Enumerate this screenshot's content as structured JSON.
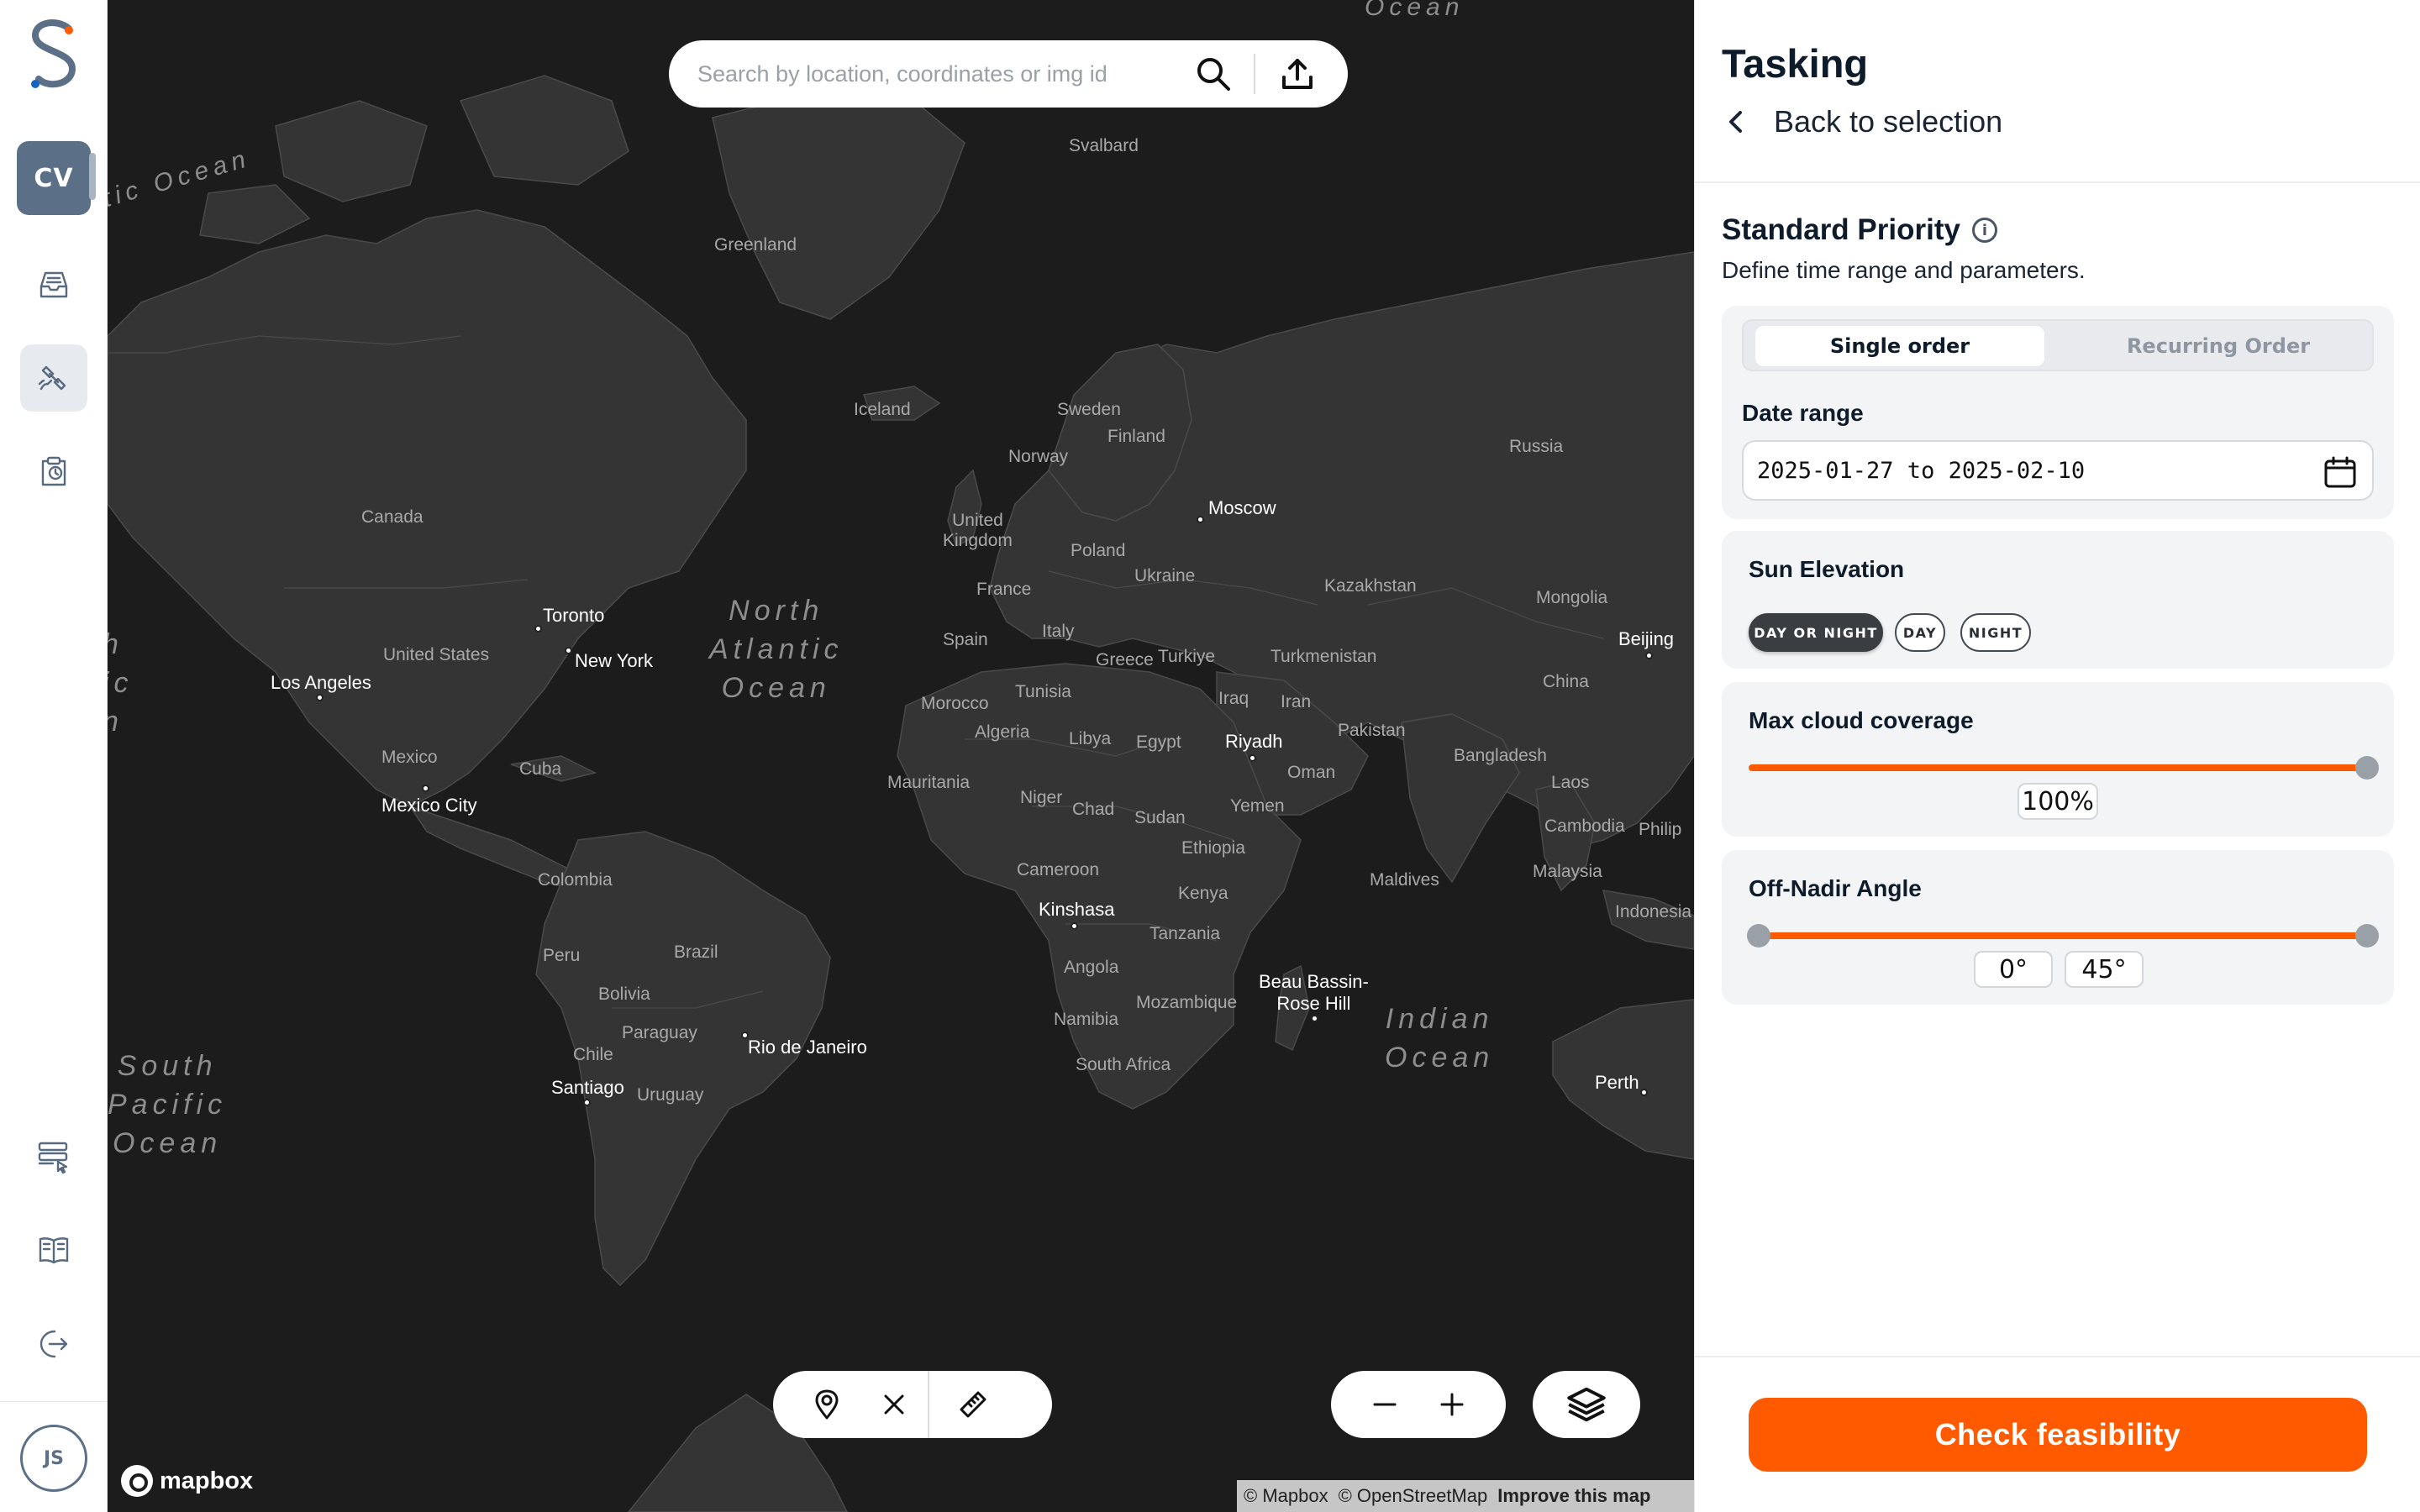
{
  "rail": {
    "workspace_initials": "CV",
    "user_initials": "JS",
    "items": [
      {
        "icon": "inbox-icon"
      },
      {
        "icon": "satellite-icon",
        "active": true
      },
      {
        "icon": "history-clipboard-icon"
      },
      {
        "icon": "api-settings-icon"
      },
      {
        "icon": "book-icon"
      },
      {
        "icon": "logout-icon"
      }
    ]
  },
  "search": {
    "placeholder": "Search by location, coordinates or img id"
  },
  "map": {
    "labels": {
      "arctic": "tic Ocean",
      "svalbard": "Svalbard",
      "greenland": "Greenland",
      "iceland": "Iceland",
      "sweden": "Sweden",
      "finland": "Finland",
      "norway": "Norway",
      "russia": "Russia",
      "canada": "Canada",
      "uk": "United\nKingdom",
      "moscow": "Moscow",
      "poland": "Poland",
      "ukraine": "Ukraine",
      "france": "France",
      "kazakhstan": "Kazakhstan",
      "mongolia": "Mongolia",
      "toronto": "Toronto",
      "new_york": "New York",
      "united_states": "United States",
      "los_angeles": "Los Angeles",
      "north_atlantic": "North\nAtlantic\nOcean",
      "spain": "Spain",
      "italy": "Italy",
      "greece": "Greece",
      "turkiye": "Turkiye",
      "turkmenistan": "Turkmenistan",
      "beijing": "Beijing",
      "china": "China",
      "tunisia": "Tunisia",
      "morocco": "Morocco",
      "iraq": "Iraq",
      "iran": "Iran",
      "algeria": "Algeria",
      "libya": "Libya",
      "egypt": "Egypt",
      "riyadh": "Riyadh",
      "pakistan": "Pakistan",
      "mexico": "Mexico",
      "cuba": "Cuba",
      "mexico_city": "Mexico City",
      "mauritania": "Mauritania",
      "niger": "Niger",
      "chad": "Chad",
      "sudan": "Sudan",
      "oman": "Oman",
      "bangladesh": "Bangladesh",
      "yemen": "Yemen",
      "laos": "Laos",
      "ethiopia": "Ethiopia",
      "cambodia": "Cambodia",
      "philippines": "Philip",
      "colombia": "Colombia",
      "cameroon": "Cameroon",
      "kenya": "Kenya",
      "malaysia": "Malaysia",
      "maldives": "Maldives",
      "kinshasa": "Kinshasa",
      "indonesia": "Indonesia",
      "tanzania": "Tanzania",
      "peru": "Peru",
      "brazil": "Brazil",
      "angola": "Angola",
      "bolivia": "Bolivia",
      "beau_bassin": "Beau Bassin-\nRose Hill",
      "mozambique": "Mozambique",
      "paraguay": "Paraguay",
      "namibia": "Namibia",
      "indian_ocean": "Indian\nOcean",
      "chile": "Chile",
      "rio": "Rio de Janeiro",
      "south_africa": "South Africa",
      "santiago": "Santiago",
      "uruguay": "Uruguay",
      "perth": "Perth",
      "south_pacific": "South\nPacific\nOcean",
      "pacific_edge": "h\nic\nn",
      "top_ocean": "Ocean"
    },
    "brand": "mapbox",
    "attribution": {
      "mapbox": "© Mapbox",
      "osm": "© OpenStreetMap",
      "improve": "Improve this map"
    }
  },
  "panel": {
    "title": "Tasking",
    "back_label": "Back to selection",
    "section_title": "Standard Priority",
    "section_sub": "Define time range and parameters.",
    "order_tabs": [
      {
        "label": "Single order",
        "selected": true
      },
      {
        "label": "Recurring Order",
        "selected": false
      }
    ],
    "date_range": {
      "label": "Date range",
      "value": "2025-01-27 to 2025-02-10"
    },
    "sun_elevation": {
      "label": "Sun Elevation",
      "options": [
        {
          "label": "DAY OR NIGHT",
          "selected": true
        },
        {
          "label": "DAY",
          "selected": false
        },
        {
          "label": "NIGHT",
          "selected": false
        }
      ]
    },
    "cloud": {
      "label": "Max cloud coverage",
      "value_text": "100%",
      "value": 1.0
    },
    "off_nadir": {
      "label": "Off-Nadir Angle",
      "min_text": "0°",
      "max_text": "45°",
      "min": 0,
      "max": 45
    },
    "cta_label": "Check feasibility"
  },
  "colors": {
    "accent": "#ff5a00",
    "map_bg": "#1c1c1c",
    "land": "#343434",
    "rail_icon": "#586a80"
  }
}
